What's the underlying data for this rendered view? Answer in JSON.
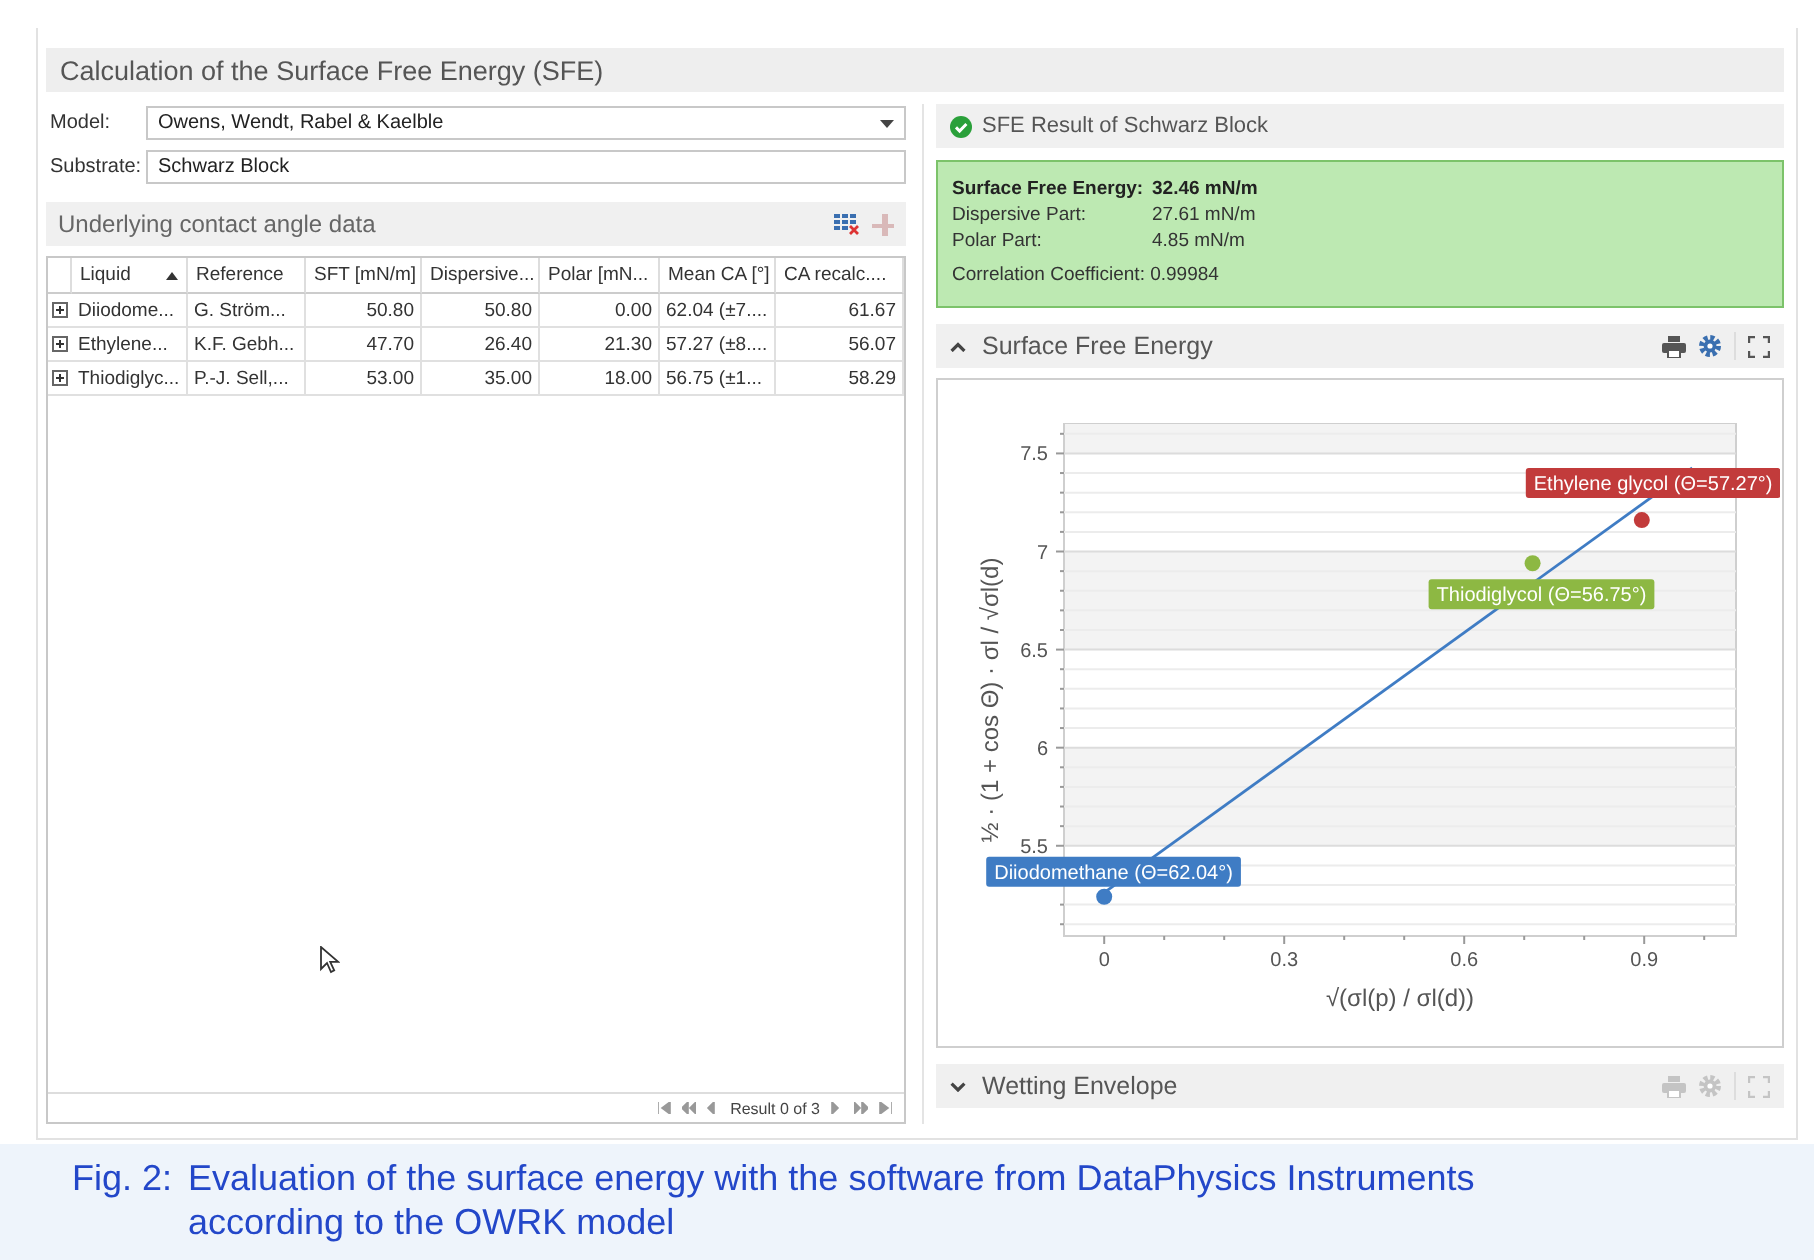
{
  "title": "Calculation of the Surface Free Energy (SFE)",
  "model": {
    "label": "Model:",
    "value": "Owens, Wendt, Rabel & Kaelble"
  },
  "substrate": {
    "label": "Substrate:",
    "value": "Schwarz Block"
  },
  "contact_angle_data": {
    "title": "Underlying contact angle data",
    "columns": [
      {
        "label": "Liquid",
        "kind": "text",
        "sorted": true
      },
      {
        "label": "Reference",
        "kind": "text",
        "sorted": false
      },
      {
        "label": "SFT [mN/m]",
        "kind": "number",
        "sorted": false
      },
      {
        "label": "Dispersive...",
        "kind": "number",
        "sorted": false
      },
      {
        "label": "Polar [mN...",
        "kind": "number",
        "sorted": false
      },
      {
        "label": "Mean CA [°]",
        "kind": "text",
        "sorted": false
      },
      {
        "label": "CA recalc....",
        "kind": "number",
        "sorted": false
      }
    ],
    "rows": [
      {
        "expanded": false,
        "cells": [
          "Diiodome...",
          "G. Ström...",
          "50.80",
          "50.80",
          "0.00",
          "62.04 (±7....",
          "61.67"
        ]
      },
      {
        "expanded": false,
        "cells": [
          "Ethylene...",
          "K.F. Gebh...",
          "47.70",
          "26.40",
          "21.30",
          "57.27 (±8....",
          "56.07"
        ]
      },
      {
        "expanded": false,
        "cells": [
          "Thiodiglyc...",
          "P.-J. Sell,...",
          "53.00",
          "35.00",
          "18.00",
          "56.75 (±1...",
          "58.29"
        ]
      }
    ],
    "pager": "Result 0 of 3"
  },
  "result": {
    "title": "SFE Result of Schwarz Block",
    "success": true,
    "fields": [
      {
        "label": "Surface Free Energy:",
        "value": "32.46 mN/m",
        "emphasis": true
      },
      {
        "label": "Dispersive Part:",
        "value": "27.61 mN/m",
        "emphasis": false
      },
      {
        "label": "Polar Part:",
        "value": "4.85 mN/m",
        "emphasis": false
      }
    ],
    "correlation": {
      "label": "Correlation Coefficient:",
      "value": "0.99984"
    }
  },
  "sections": [
    {
      "title": "Surface Free Energy",
      "expanded": true,
      "tools_enabled": true,
      "chart_data": {
        "type": "scatter",
        "xlabel": "√(σl(p) / σl(d))",
        "ylabel": "½ · (1 + cos Θ) · σl / √σl(d)",
        "x": [
          0,
          0.714,
          0.896
        ],
        "series": [
          {
            "name": "Diiodomethane (Θ=62.04°)",
            "color": "#3f7cc4",
            "values": [
              5.24,
              null,
              null
            ]
          },
          {
            "name": "Thiodiglycol (Θ=56.75°)",
            "color": "#8db843",
            "values": [
              null,
              6.94,
              null
            ]
          },
          {
            "name": "Ethylene glycol (Θ=57.27°)",
            "color": "#c23b3b",
            "values": [
              null,
              null,
              7.16
            ]
          }
        ],
        "xlim": [
          -0.067,
          1.053
        ],
        "ylim": [
          5.04,
          7.65
        ],
        "xticks": [
          0,
          0.3,
          0.6,
          0.9
        ],
        "yticks": [
          5.5,
          6,
          6.5,
          7,
          7.5
        ],
        "grid": true,
        "legend": true
      }
    },
    {
      "title": "Wetting Envelope",
      "expanded": false,
      "tools_enabled": false
    }
  ],
  "caption": {
    "label": "Fig. 2:",
    "text": "Evaluation of the surface energy with the software from DataPhysics Instruments according to the OWRK model"
  }
}
